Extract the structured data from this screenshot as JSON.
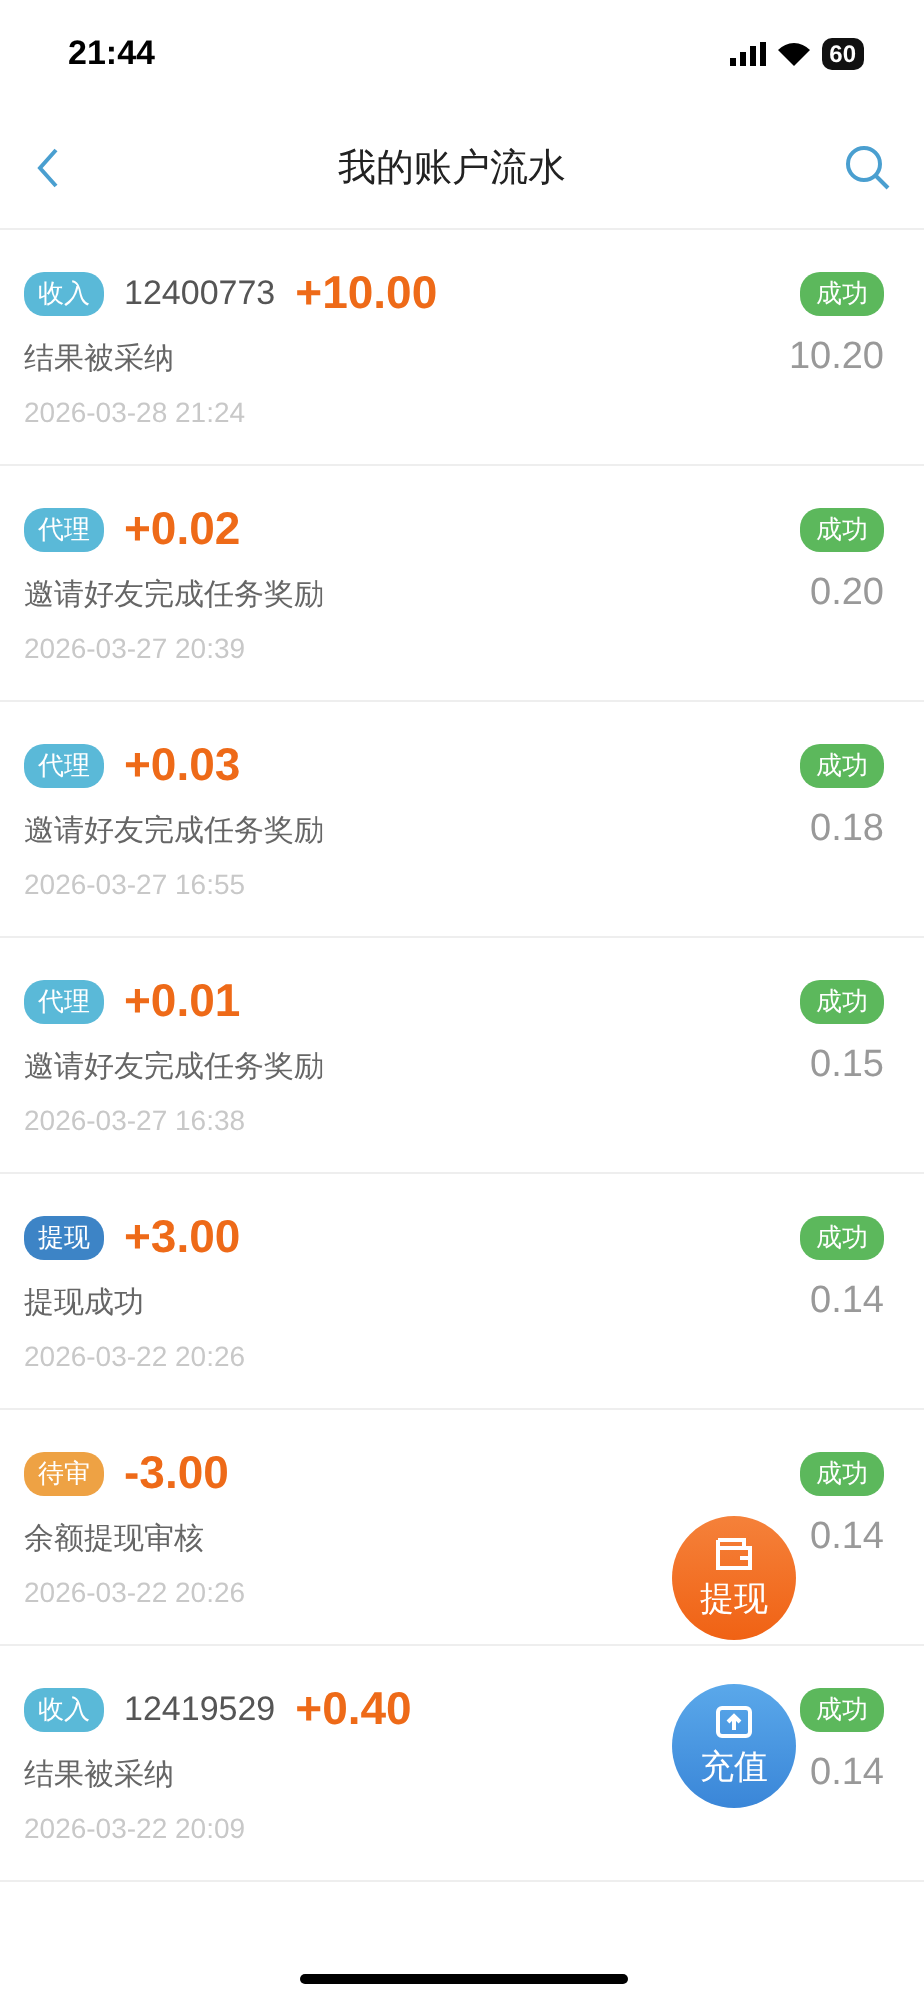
{
  "status_bar": {
    "time": "21:44",
    "battery": "60"
  },
  "header": {
    "title": "我的账户流水"
  },
  "records": [
    {
      "tag": "收入",
      "color": "#5ab9d8",
      "order": "12400773",
      "amount": "+10.00",
      "status": "成功",
      "desc": "结果被采纳",
      "balance": "10.20",
      "time": "2026-03-28 21:24"
    },
    {
      "tag": "代理",
      "color": "#5ab9d8",
      "amount": "+0.02",
      "status": "成功",
      "desc": "邀请好友完成任务奖励",
      "balance": "0.20",
      "time": "2026-03-27 20:39"
    },
    {
      "tag": "代理",
      "color": "#5ab9d8",
      "amount": "+0.03",
      "status": "成功",
      "desc": "邀请好友完成任务奖励",
      "balance": "0.18",
      "time": "2026-03-27 16:55"
    },
    {
      "tag": "代理",
      "color": "#5ab9d8",
      "amount": "+0.01",
      "status": "成功",
      "desc": "邀请好友完成任务奖励",
      "balance": "0.15",
      "time": "2026-03-27 16:38"
    },
    {
      "tag": "提现",
      "color": "#3d84c6",
      "amount": "+3.00",
      "status": "成功",
      "desc": "提现成功",
      "balance": "0.14",
      "time": "2026-03-22 20:26"
    },
    {
      "tag": "待审",
      "color": "#eea244",
      "amount": "-3.00",
      "status": "成功",
      "desc": "余额提现审核",
      "balance": "0.14",
      "time": "2026-03-22 20:26"
    },
    {
      "tag": "收入",
      "color": "#5ab9d8",
      "order": "12419529",
      "amount": "+0.40",
      "status": "成功",
      "desc": "结果被采纳",
      "balance": "0.14",
      "time": "2026-03-22 20:09"
    }
  ],
  "fabs": [
    {
      "kind": "withdraw",
      "label": "提现"
    },
    {
      "kind": "recharge",
      "label": "充值"
    }
  ]
}
